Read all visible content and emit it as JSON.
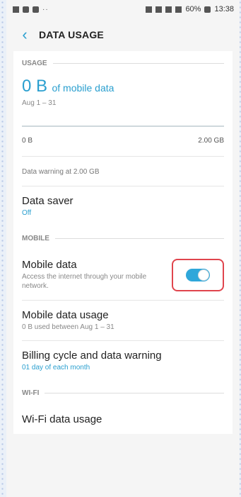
{
  "status_bar": {
    "dots": "··",
    "battery": "60%",
    "time": "13:38"
  },
  "header": {
    "back_icon": "chevron-left-icon",
    "title": "DATA USAGE"
  },
  "usage": {
    "section_label": "USAGE",
    "amount": "0 B",
    "amount_suffix": "of mobile data",
    "range": "Aug 1 – 31",
    "bar_min": "0 B",
    "bar_max": "2.00 GB",
    "bar_fill_fraction": 0,
    "warning": "Data warning at 2.00 GB"
  },
  "data_saver": {
    "title": "Data saver",
    "state": "Off"
  },
  "mobile": {
    "section_label": "MOBILE",
    "mobile_data": {
      "title": "Mobile data",
      "subtitle": "Access the internet through your mobile network.",
      "enabled": true
    },
    "mobile_data_usage": {
      "title": "Mobile data usage",
      "subtitle": "0 B used between Aug 1 – 31"
    },
    "billing": {
      "title": "Billing cycle and data warning",
      "subtitle": "01 day of each month"
    }
  },
  "wifi": {
    "section_label": "WI-FI",
    "wifi_data_usage": {
      "title": "Wi-Fi data usage"
    }
  },
  "colors": {
    "accent": "#2a9fcf",
    "highlight_border": "#e0454d"
  }
}
